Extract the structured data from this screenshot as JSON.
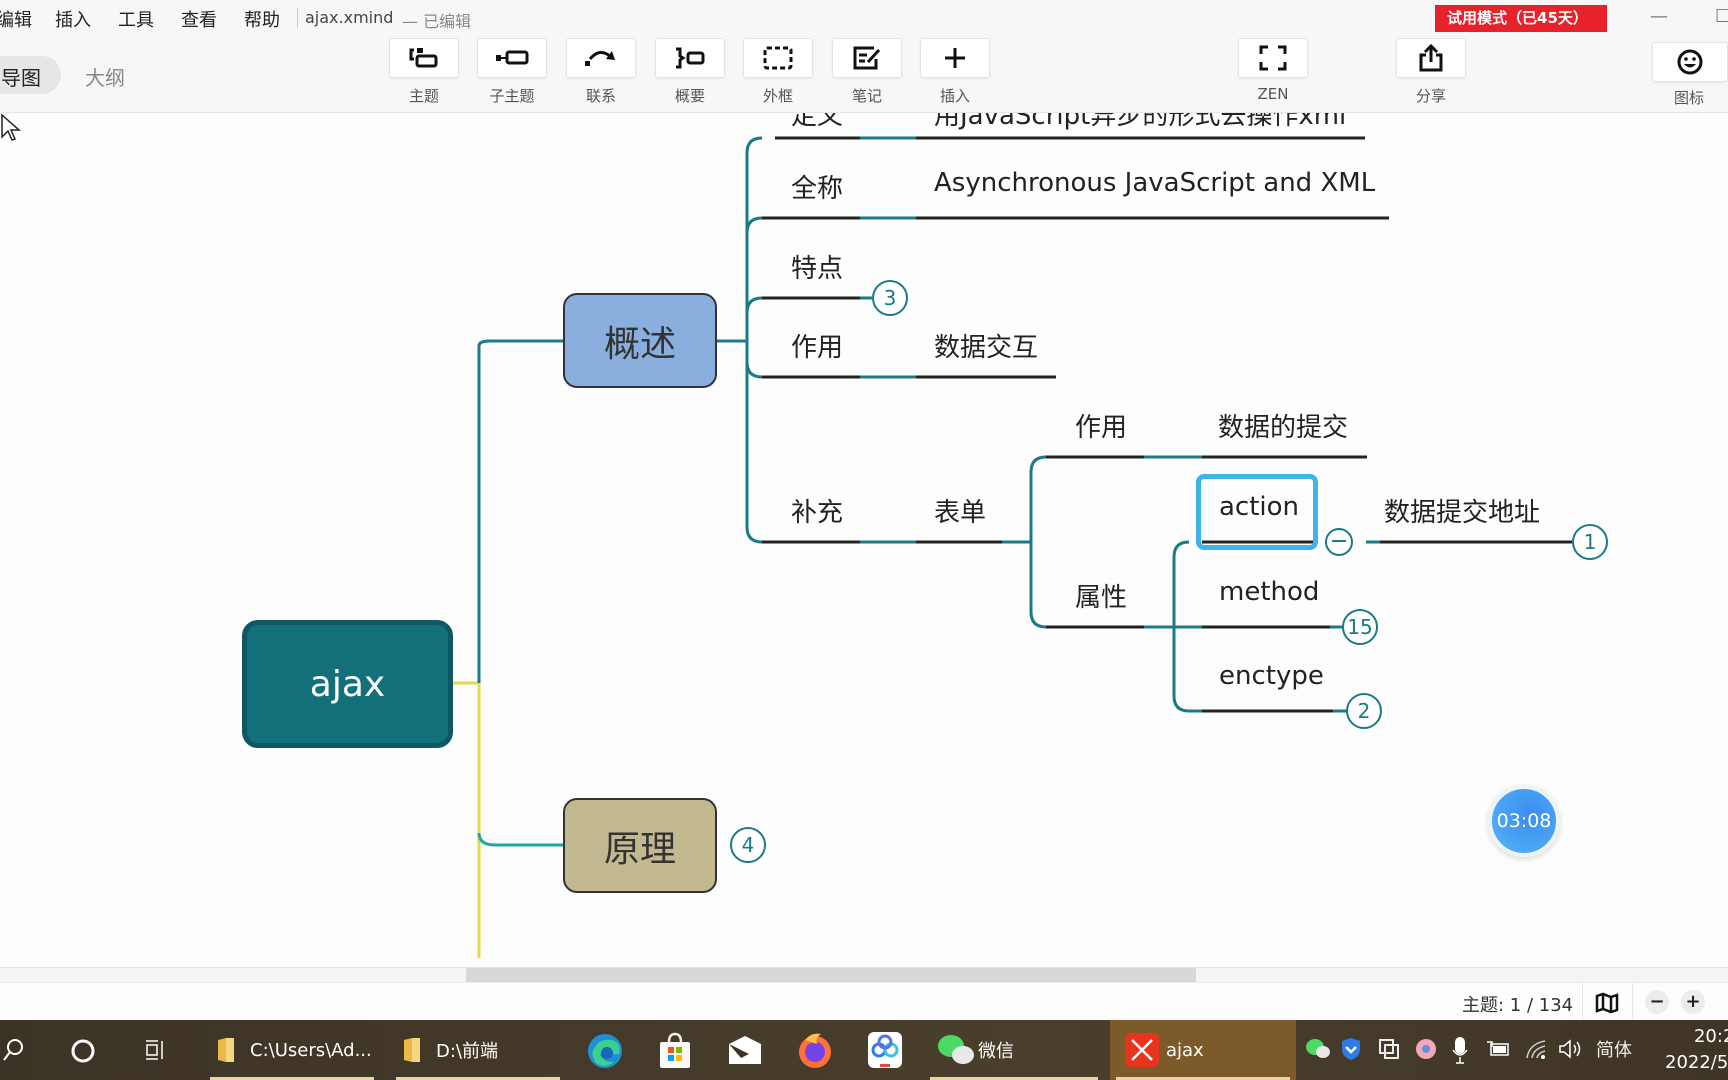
{
  "menu": {
    "items": [
      "编辑",
      "插入",
      "工具",
      "查看",
      "帮助"
    ],
    "file_name": "ajax.xmind",
    "edited_status": "— 已编辑",
    "trial_badge": "试用模式（已45天）"
  },
  "toolbar": {
    "view_tabs": {
      "mindmap": "导图",
      "outline": "大纲"
    },
    "buttons": [
      {
        "label": "主题",
        "icon": "topic-icon"
      },
      {
        "label": "子主题",
        "icon": "subtopic-icon"
      },
      {
        "label": "联系",
        "icon": "relationship-icon"
      },
      {
        "label": "概要",
        "icon": "summary-icon"
      },
      {
        "label": "外框",
        "icon": "boundary-icon"
      },
      {
        "label": "笔记",
        "icon": "note-icon"
      },
      {
        "label": "插入",
        "icon": "plus-icon"
      },
      {
        "label": "ZEN",
        "icon": "fullscreen-icon"
      },
      {
        "label": "分享",
        "icon": "share-icon"
      },
      {
        "label": "图标",
        "icon": "smiley-icon"
      }
    ]
  },
  "mindmap": {
    "central": "ajax",
    "main_topics": [
      {
        "label": "概述",
        "color": "#8aafde"
      },
      {
        "label": "原理",
        "color": "#c3b991",
        "collapsed_count": "4"
      }
    ],
    "overview": {
      "rows": [
        {
          "label": "定义",
          "value": "用JavaScript异步的形式去操作xml"
        },
        {
          "label": "全称",
          "value": "Asynchronous  JavaScript and XML"
        },
        {
          "label": "特点",
          "collapsed_count": "3"
        },
        {
          "label": "作用",
          "value": "数据交互"
        },
        {
          "label": "补充",
          "value": "表单"
        }
      ],
      "form": {
        "purpose_label": "作用",
        "purpose_value": "数据的提交",
        "attr_label": "属性",
        "attrs": [
          {
            "name": "action",
            "value": "数据提交地址",
            "collapsed_count": "1",
            "selected": true
          },
          {
            "name": "method",
            "collapsed_count": "15"
          },
          {
            "name": "enctype",
            "collapsed_count": "2"
          }
        ]
      }
    },
    "colors": {
      "branch": "#1a7a86",
      "trunk_yellow": "#e6d84a",
      "selection": "#3db4ea"
    }
  },
  "timer": "03:08",
  "status": {
    "topic_count": "主题: 1 / 134"
  },
  "taskbar": {
    "items": [
      {
        "label": "C:\\Users\\Ad...",
        "icon": "folder-icon"
      },
      {
        "label": "D:\\前端",
        "icon": "folder-icon"
      },
      {
        "label": "微信",
        "icon": "wechat-icon"
      },
      {
        "label": "ajax",
        "icon": "xmind-icon",
        "active": true
      }
    ],
    "ime": "简体",
    "time": "20:2",
    "date": "2022/5/"
  }
}
